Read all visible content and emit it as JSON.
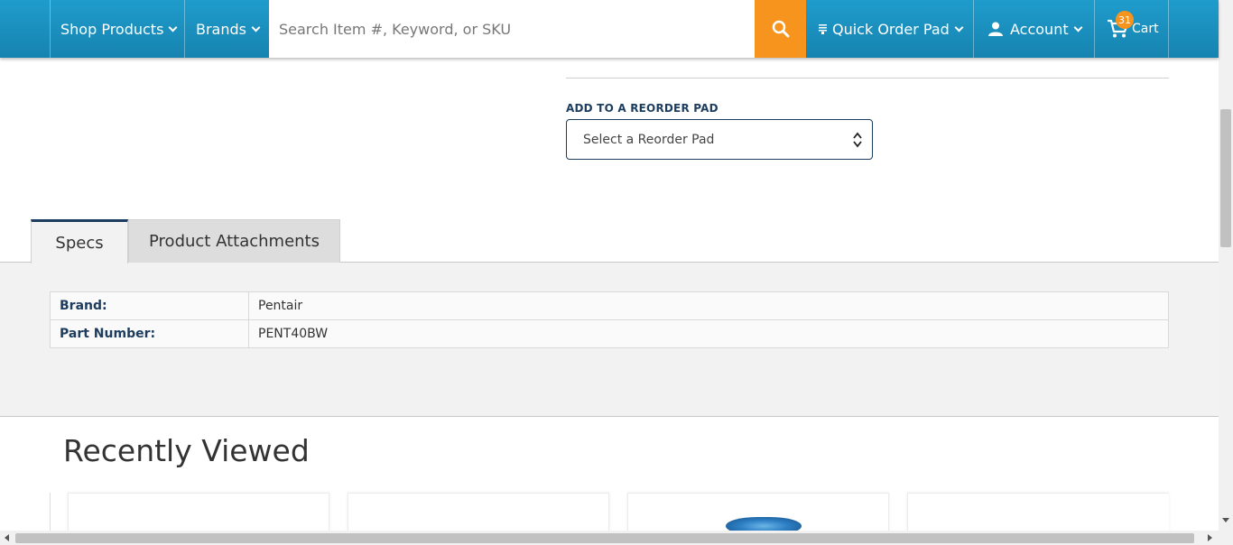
{
  "nav": {
    "shop_products": "Shop Products",
    "brands": "Brands",
    "search_placeholder": "Search Item #, Keyword, or SKU",
    "quick_order_pad": "Quick Order Pad",
    "account": "Account",
    "cart_label": "Cart",
    "cart_count": "31"
  },
  "reorder": {
    "label": "ADD TO A REORDER PAD",
    "select_value": "Select a Reorder Pad"
  },
  "tabs": [
    {
      "label": "Specs",
      "active": true
    },
    {
      "label": "Product Attachments",
      "active": false
    }
  ],
  "specs": [
    {
      "key": "Brand:",
      "value": "Pentair"
    },
    {
      "key": "Part Number:",
      "value": "PENT40BW"
    }
  ],
  "recently_viewed": {
    "title": "Recently Viewed"
  },
  "colors": {
    "nav_blue": "#1a8fbf",
    "accent_orange": "#f7941d",
    "navy_text": "#1d3d5f"
  }
}
